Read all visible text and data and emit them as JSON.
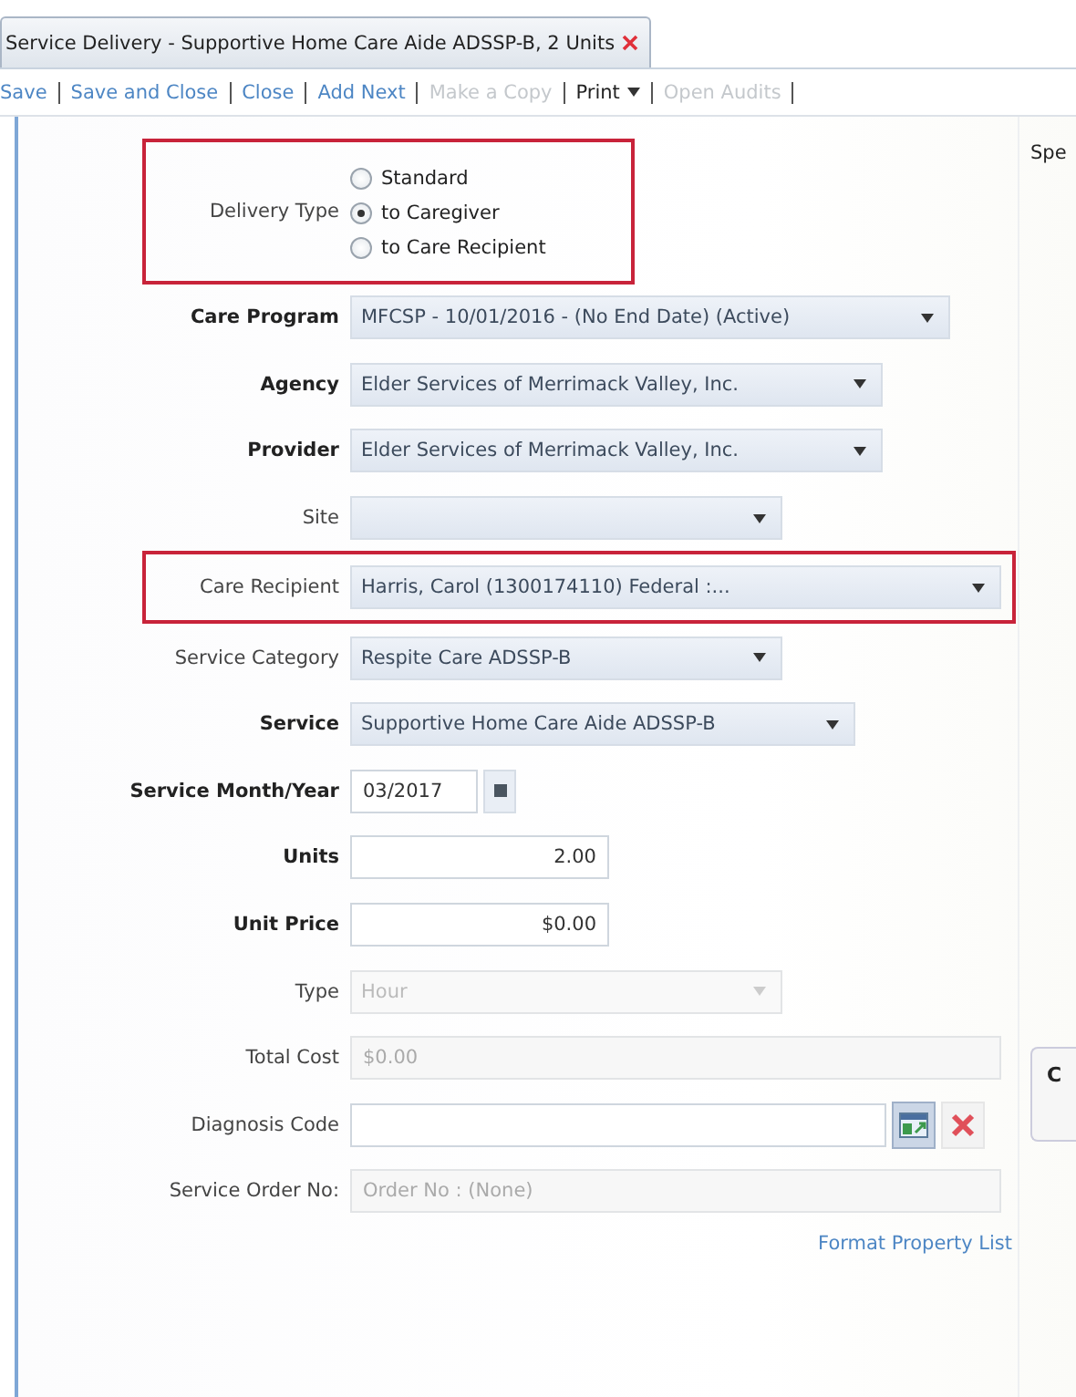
{
  "tab": {
    "title": "Service Delivery - Supportive Home Care Aide ADSSP-B, 2 Units",
    "selected": true
  },
  "toolbar": [
    {
      "label": "Save",
      "kind": "link",
      "disabled": false
    },
    {
      "label": "Save and Close",
      "kind": "link",
      "disabled": false
    },
    {
      "label": "Close",
      "kind": "link",
      "disabled": false
    },
    {
      "label": "Add Next",
      "kind": "link",
      "disabled": false
    },
    {
      "label": "Make a Copy",
      "kind": "link",
      "disabled": true
    },
    {
      "label": "Print",
      "kind": "menu",
      "disabled": false
    },
    {
      "label": "Open Audits",
      "kind": "link",
      "disabled": true
    }
  ],
  "form": {
    "delivery_type": {
      "label": "Delivery Type",
      "highlighted": true,
      "options": [
        {
          "label": "Standard",
          "selected": false
        },
        {
          "label": "to Caregiver",
          "selected": true
        },
        {
          "label": "to Care Recipient",
          "selected": false
        }
      ]
    },
    "fields": [
      {
        "label": "Care Program",
        "bold": true,
        "kind": "select",
        "value": "MFCSP - 10/01/2016 - (No End Date) (Active)",
        "disabled": false,
        "highlighted": false
      },
      {
        "label": "Agency",
        "bold": true,
        "kind": "select",
        "value": "Elder Services of Merrimack Valley, Inc.",
        "disabled": false,
        "highlighted": false
      },
      {
        "label": "Provider",
        "bold": true,
        "kind": "select",
        "value": "Elder Services of Merrimack Valley, Inc.",
        "disabled": false,
        "highlighted": false
      },
      {
        "label": "Site",
        "bold": false,
        "kind": "select",
        "disabled": false,
        "highlighted": false
      },
      {
        "label": "Care Recipient",
        "bold": false,
        "kind": "select",
        "value": "Harris, Carol (1300174110) Federal :...",
        "disabled": false,
        "highlighted": true
      },
      {
        "label": "Service Category",
        "bold": false,
        "kind": "select",
        "value": "Respite Care ADSSP-B",
        "disabled": false,
        "highlighted": false
      },
      {
        "label": "Service",
        "bold": true,
        "kind": "select",
        "value": "Supportive Home Care Aide ADSSP-B",
        "disabled": false,
        "highlighted": false
      },
      {
        "label": "Service Month/Year",
        "bold": true,
        "kind": "date",
        "value": "03/2017",
        "disabled": false,
        "highlighted": false
      },
      {
        "label": "Units",
        "bold": true,
        "kind": "number",
        "value": "2.00",
        "disabled": false,
        "highlighted": false
      },
      {
        "label": "Unit Price",
        "bold": true,
        "kind": "number",
        "value": "$0.00",
        "disabled": false,
        "highlighted": false
      },
      {
        "label": "Type",
        "bold": false,
        "kind": "select",
        "value": "Hour",
        "disabled": true,
        "highlighted": false
      },
      {
        "label": "Total Cost",
        "bold": false,
        "kind": "text",
        "value": "$0.00",
        "disabled": true,
        "highlighted": false
      },
      {
        "label": "Diagnosis Code",
        "bold": false,
        "kind": "lookup",
        "disabled": false,
        "highlighted": false
      },
      {
        "label": "Service Order No:",
        "bold": false,
        "kind": "text",
        "value": "Order No : (None)",
        "disabled": true,
        "highlighted": false
      }
    ],
    "footer_link": "Format Property List"
  },
  "side_panel": {
    "heading": "Spe",
    "card_title": "C"
  }
}
